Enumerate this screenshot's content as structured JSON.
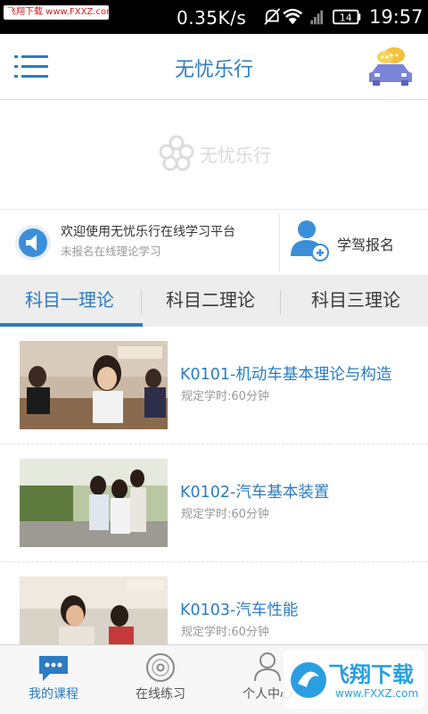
{
  "status_bar": {
    "watermark": "飞翔下载 www.FXXZ.com",
    "net_speed": "0.35K/s",
    "battery": "14",
    "time": "19:57"
  },
  "header": {
    "title": "无忧乐行",
    "menu_icon": "menu-icon",
    "right_icon": "car-chat-icon"
  },
  "banner": {
    "logo_text": "无忧乐行"
  },
  "notice": {
    "line1": "欢迎使用无忧乐行在线学习平台",
    "line2": "未报名在线理论学习"
  },
  "enroll": {
    "label": "学驾报名"
  },
  "tabs": [
    {
      "label": "科目一理论",
      "active": true
    },
    {
      "label": "科目二理论",
      "active": false
    },
    {
      "label": "科目三理论",
      "active": false
    }
  ],
  "courses": [
    {
      "title": "K0101-机动车基本理论与构造",
      "subtitle": "规定学时:60分钟"
    },
    {
      "title": "K0102-汽车基本装置",
      "subtitle": "规定学时:60分钟"
    },
    {
      "title": "K0103-汽车性能",
      "subtitle": "规定学时:60分钟"
    }
  ],
  "bottom_nav": [
    {
      "label": "我的课程",
      "icon": "chat-bubble-icon",
      "active": true
    },
    {
      "label": "在线练习",
      "icon": "disc-icon",
      "active": false
    },
    {
      "label": "个人中心",
      "icon": "person-icon",
      "active": false
    }
  ],
  "bottom_watermark": {
    "title": "飞翔下载",
    "url": "www.FXXZ.com"
  },
  "colors": {
    "accent": "#2b7cc2",
    "tab_bg": "#ededed"
  }
}
